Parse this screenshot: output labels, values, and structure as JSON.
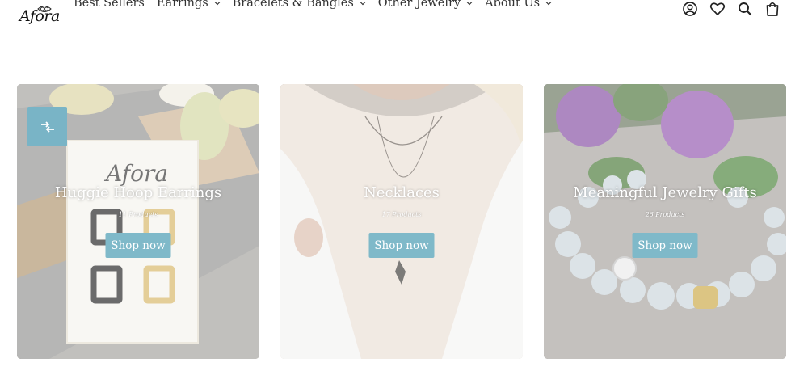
{
  "brand": {
    "logo_text": "Afora"
  },
  "nav": {
    "items": [
      {
        "label": "Best Sellers",
        "dropdown": false
      },
      {
        "label": "Earrings",
        "dropdown": true
      },
      {
        "label": "Bracelets & Bangles",
        "dropdown": true
      },
      {
        "label": "Other Jewelry",
        "dropdown": true
      },
      {
        "label": "About Us",
        "dropdown": true
      }
    ]
  },
  "header_icons": {
    "account": "user-circle-icon",
    "wishlist": "heart-icon",
    "wishlist_count": "0",
    "search": "search-icon",
    "cart": "shopping-bag-icon",
    "cart_count": "0"
  },
  "collections": [
    {
      "title": "Huggie Hoop Earrings",
      "count": "11 Products",
      "button": "Shop now",
      "compare_icon": "arrows-compare-icon"
    },
    {
      "title": "Necklaces",
      "count": "17 Products",
      "button": "Shop now"
    },
    {
      "title": "Meaningful Jewelry Gifts",
      "count": "26 Products",
      "button": "Shop now"
    }
  ],
  "colors": {
    "accent": "#7fb9c9",
    "text": "#333333",
    "background": "#ffffff"
  }
}
